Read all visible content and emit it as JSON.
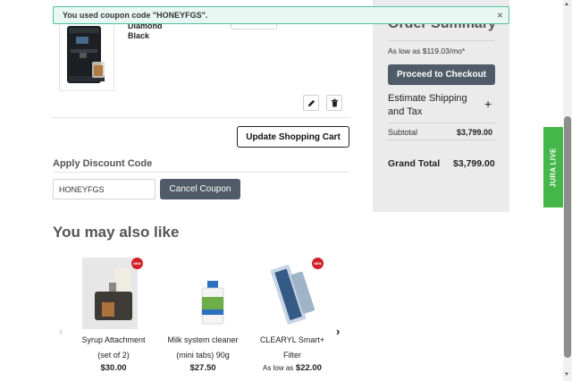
{
  "toast": {
    "message": "You used coupon code \"HONEYFGS\".",
    "close": "×"
  },
  "cart_item": {
    "name_line1": "Diamond",
    "name_line2": "Black",
    "edit_icon": "pencil-icon",
    "delete_icon": "trash-icon"
  },
  "cart": {
    "update_label": "Update Shopping Cart"
  },
  "discount": {
    "title": "Apply Discount Code",
    "code_value": "HONEYFGS",
    "cancel_label": "Cancel Coupon"
  },
  "also_like": {
    "title": "You may also like",
    "products": [
      {
        "name_line1": "Syrup Attachment",
        "name_line2": "(set of 2)",
        "price_prefix": "",
        "price": "$30.00",
        "badge": "NEW"
      },
      {
        "name_line1": "Milk system cleaner",
        "name_line2": "(mini tabs) 90g",
        "price_prefix": "",
        "price": "$27.50",
        "badge": ""
      },
      {
        "name_line1": "CLEARYL Smart+",
        "name_line2": "Filter",
        "price_prefix": "As low as",
        "price": "$22.00",
        "badge": "NEW"
      }
    ],
    "prev_icon": "‹",
    "next_icon": "›"
  },
  "summary": {
    "title": "Order Summary",
    "financing": "As low as $119.03/mo*",
    "checkout_label": "Proceed to Checkout",
    "shipping_label": "Estimate Shipping and Tax",
    "shipping_toggle": "+",
    "subtotal_label": "Subtotal",
    "subtotal_value": "$3,799.00",
    "grand_label": "Grand Total",
    "grand_value": "$3,799.00"
  },
  "live_tab": {
    "label": "JURA LIVE"
  },
  "colors": {
    "accent_dark": "#4f5b66",
    "toast_border": "#4fbfa1",
    "live_green": "#45b649",
    "badge_red": "#d12028"
  }
}
